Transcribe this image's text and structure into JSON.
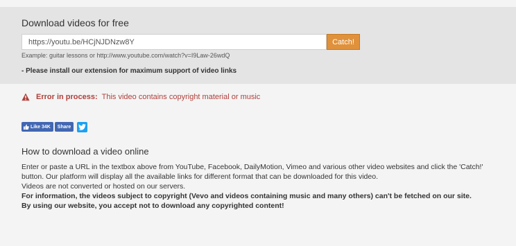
{
  "panel": {
    "title": "Download videos for free",
    "url_value": "https://youtu.be/HCjNJDNzw8Y",
    "catch_label": "Catch!",
    "example": "Example: guitar lessons or http://www.youtube.com/watch?v=I9Law-26wdQ",
    "extension_note": "- Please install our extension for maximum support of video links"
  },
  "error": {
    "icon": "warning-triangle-icon",
    "label": "Error in process:",
    "message": "This video contains copyright material or music",
    "color": "#b0403b"
  },
  "social": {
    "like_label": "Like 34K",
    "share_label": "Share",
    "facebook_color": "#4267b2",
    "twitter_icon": "twitter-bird-icon",
    "twitter_color": "#1da1f2"
  },
  "how_to": {
    "title": "How to download a video online",
    "paragraph1": "Enter or paste a URL in the textbox above from YouTube, Facebook, DailyMotion, Vimeo and various other video websites and click the 'Catch!' button. Our platform will display all the available links for different format that can be downloaded for this video.",
    "paragraph2": "Videos are not converted or hosted on our servers.",
    "paragraph3": "For information, the videos subject to copyright (Vevo and videos containing music and many others) can't be fetched on our site.",
    "paragraph4": "By using our website, you accept not to download any copyrighted content!"
  },
  "colors": {
    "panel_bg": "#e4e4e4",
    "page_bg": "#f4f4f4",
    "catch_button": "#e0913b"
  }
}
